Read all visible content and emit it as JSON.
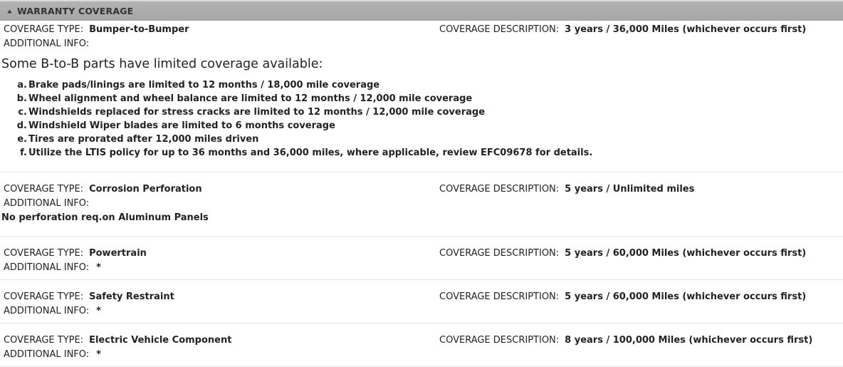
{
  "section": {
    "title": "WARRANTY COVERAGE",
    "toggle_icon": "triangle-up-icon"
  },
  "labels": {
    "coverage_type": "COVERAGE TYPE:",
    "coverage_description": "COVERAGE DESCRIPTION:",
    "additional_info": "ADDITIONAL INFO:"
  },
  "coverages": [
    {
      "type": "Bumper-to-Bumper",
      "description": "3 years / 36,000 Miles (whichever occurs first)",
      "additional_info": "",
      "intro": "Some B-to-B parts have limited coverage available:",
      "limits": [
        {
          "letter": "a.",
          "text": "Brake pads/linings are limited to 12 months / 18,000 mile coverage"
        },
        {
          "letter": "b.",
          "text": "Wheel alignment and wheel balance are limited to 12 months / 12,000 mile coverage"
        },
        {
          "letter": "c.",
          "text": "Windshields replaced for stress cracks are limited to 12 months / 12,000 mile coverage"
        },
        {
          "letter": "d.",
          "text": "Windshield Wiper blades are limited to 6 months coverage"
        },
        {
          "letter": "e.",
          "text": "Tires are prorated after 12,000 miles driven"
        },
        {
          "letter": "f.",
          "text": "Utilize the LTIS policy for up to 36 months and 36,000 miles, where applicable, review EFC09678 for details."
        }
      ]
    },
    {
      "type": "Corrosion Perforation",
      "description": "5 years / Unlimited miles",
      "additional_info": "",
      "note": "No perforation req.on Aluminum Panels"
    },
    {
      "type": "Powertrain",
      "description": "5 years / 60,000 Miles (whichever occurs first)",
      "additional_info": "*"
    },
    {
      "type": "Safety Restraint",
      "description": "5 years / 60,000 Miles (whichever occurs first)",
      "additional_info": "*"
    },
    {
      "type": "Electric Vehicle Component",
      "description": "8 years / 100,000 Miles (whichever occurs first)",
      "additional_info": "*"
    }
  ]
}
